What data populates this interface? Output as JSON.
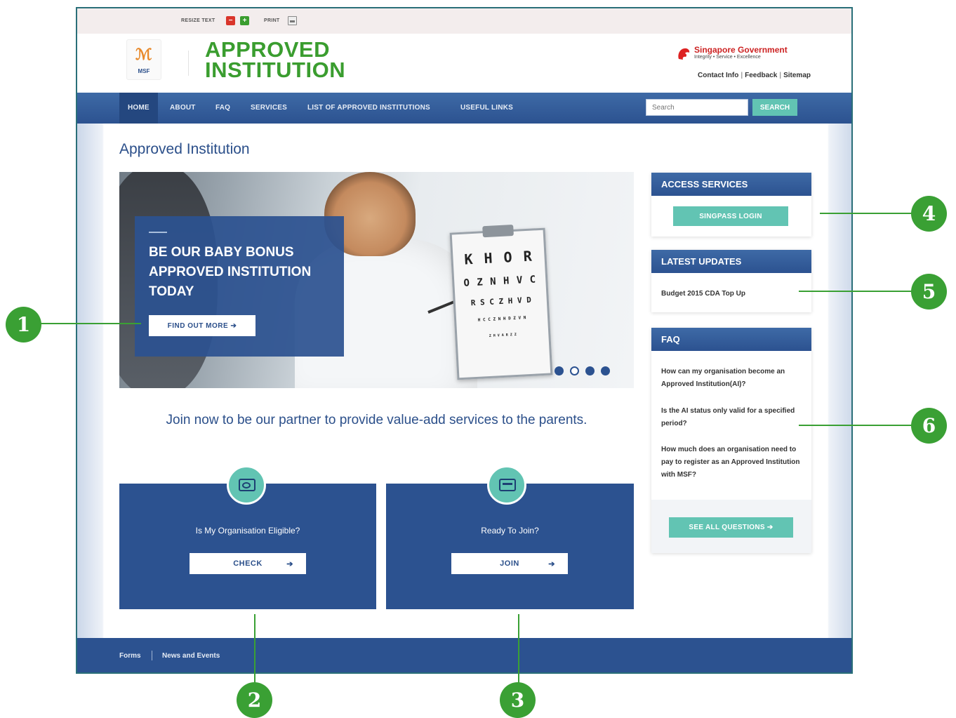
{
  "utility_bar": {
    "resize_label": "RESIZE TEXT",
    "decrease": "−",
    "increase": "+",
    "print_label": "PRINT"
  },
  "header": {
    "msf_logo_text": "MSF",
    "brand_line1": "APPROVED",
    "brand_line2": "INSTITUTION",
    "gov_name_1": "Singapore",
    "gov_name_2": "Government",
    "gov_tagline": "Integrity • Service • Excellence",
    "links": [
      "Contact Info",
      "Feedback",
      "Sitemap"
    ]
  },
  "nav": {
    "items": [
      "HOME",
      "ABOUT",
      "FAQ",
      "SERVICES",
      "LIST OF APPROVED INSTITUTIONS",
      "USEFUL LINKS"
    ],
    "active": "HOME",
    "search_placeholder": "Search",
    "search_button": "SEARCH"
  },
  "page": {
    "title": "Approved Institution"
  },
  "hero": {
    "heading": "BE OUR BABY BONUS APPROVED INSTITUTION TODAY",
    "cta": "FIND OUT MORE ➔",
    "eye_chart": [
      "K H O R",
      "O Z N H V C",
      "R S C Z H V D",
      "H C C Z N  H D Z V N",
      "Z H V  A R Z Z"
    ],
    "slides": 4,
    "active_slide": 2
  },
  "join": {
    "text": "Join now to be our partner to provide value-add services to the parents."
  },
  "tiles": [
    {
      "question": "Is My Organisation Eligible?",
      "button": "CHECK",
      "icon": "search-icon"
    },
    {
      "question": "Ready To Join?",
      "button": "JOIN",
      "icon": "id-card-icon"
    }
  ],
  "button_arrow": "➔",
  "sidebar": {
    "access_services": {
      "title": "ACCESS SERVICES",
      "button": "SINGPASS LOGIN"
    },
    "latest_updates": {
      "title": "LATEST UPDATES",
      "items": [
        "Budget 2015 CDA Top Up"
      ]
    },
    "faq": {
      "title": "FAQ",
      "items": [
        "How can my organisation become an Approved Institution(AI)?",
        "Is the AI status only valid for a specified period?",
        "How much does an organisation need to pay to register as an Approved Institution with MSF?"
      ],
      "button": "SEE ALL QUESTIONS ➔"
    }
  },
  "footer": {
    "links": [
      "Forms",
      "News and Events"
    ]
  },
  "callouts": [
    "1",
    "2",
    "3",
    "4",
    "5",
    "6"
  ],
  "colors": {
    "brand_green": "#3a9d2f",
    "nav_blue": "#2c5290",
    "accent_teal": "#62c4b3",
    "frame": "#2a6f79",
    "callout_green": "#3aa034"
  }
}
